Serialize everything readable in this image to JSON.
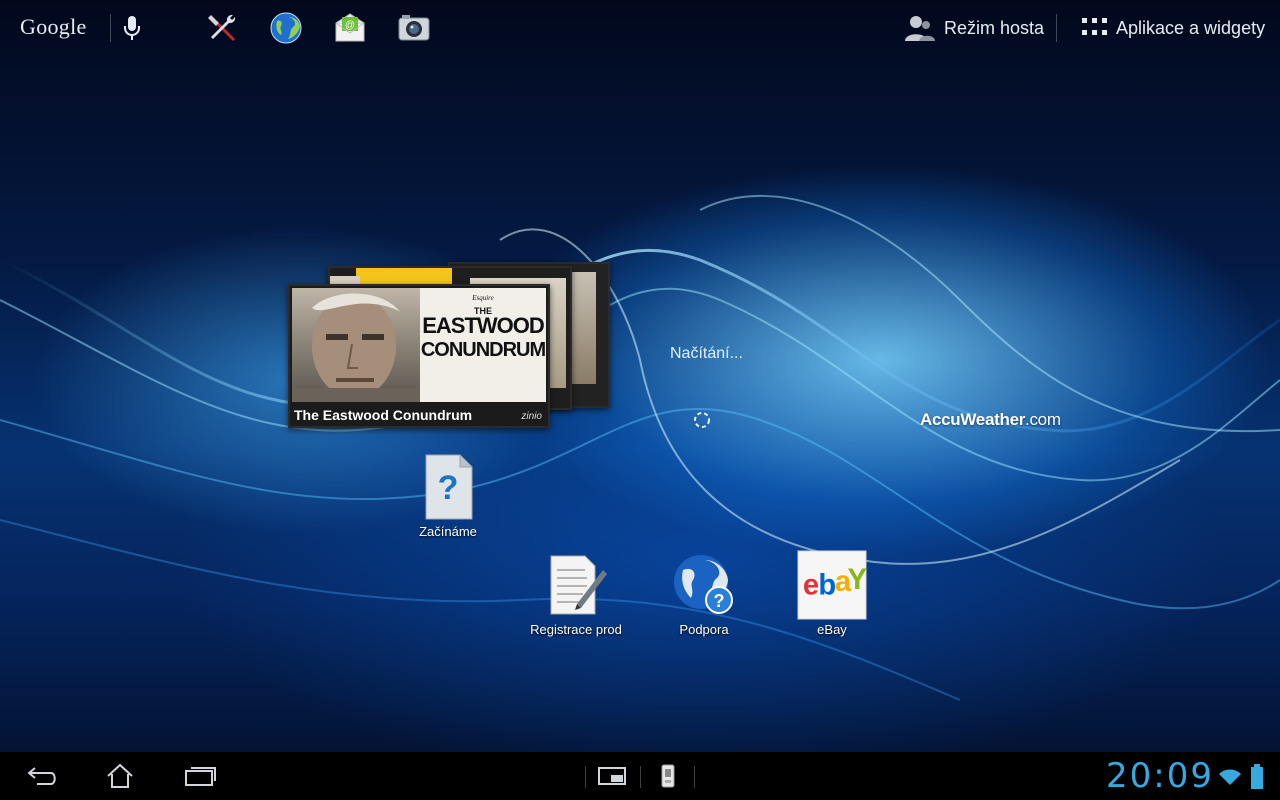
{
  "top_bar": {
    "google_label": "Google",
    "guest_mode_label": "Režim hosta",
    "apps_widgets_label": "Aplikace a widgety"
  },
  "zinio_widget": {
    "magazine_brand": "Esquire",
    "cover_line_1": "THE",
    "cover_line_2": "EASTWOOD",
    "cover_line_3": "CONUNDRUM",
    "caption": "The Eastwood Conundrum",
    "logo": "zinio"
  },
  "loading_text": "Načítání...",
  "weather_widget": {
    "brand": "AccuWeather",
    "suffix": ".com"
  },
  "shortcuts": {
    "getting_started": "Začínáme",
    "registration": "Registrace prod",
    "support": "Podpora",
    "ebay": "eBay"
  },
  "status_bar": {
    "clock": "20:09"
  },
  "colors": {
    "clock": "#37a8e0",
    "bottom_bar": "#000000"
  }
}
